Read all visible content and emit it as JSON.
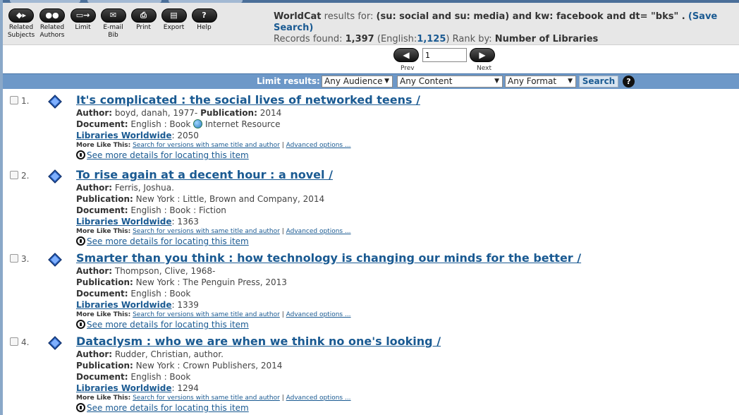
{
  "toolbar": {
    "tools": [
      {
        "label": "Related Subjects",
        "icon": "related-subjects-icon"
      },
      {
        "label": "Related Authors",
        "icon": "related-authors-icon"
      },
      {
        "label": "Limit",
        "icon": "limit-icon"
      },
      {
        "label": "E-mail Bib",
        "icon": "email-icon"
      },
      {
        "label": "Print",
        "icon": "print-icon"
      },
      {
        "label": "Export",
        "icon": "export-icon"
      },
      {
        "label": "Help",
        "icon": "help-icon"
      }
    ],
    "summary": {
      "source": "WorldCat",
      "results_for": "results for:",
      "query": "(su: social and su: media) and kw: facebook and dt= \"bks\" .",
      "save_search": "(Save Search)",
      "records_label": "Records found:",
      "records_count": "1,397",
      "english_open": "(English:",
      "english_count": "1,125",
      "english_close": ")",
      "rank_label": "Rank by:",
      "rank_value": "Number of Libraries"
    }
  },
  "pager": {
    "page_value": "1",
    "prev_label": "Prev",
    "next_label": "Next"
  },
  "limit": {
    "label": "Limit results:",
    "audience": "Any Audience",
    "content": "Any Content",
    "format": "Any Format",
    "search_label": "Search",
    "help": "?"
  },
  "results": [
    {
      "num": "1.",
      "title": "It's complicated : the social lives of networked teens /",
      "author_label": "Author:",
      "author": "boyd, danah, 1977-",
      "publication_label": "Publication:",
      "publication": "2014",
      "document_label": "Document:",
      "document": "English : Book",
      "document_extra": "Internet Resource",
      "libraries_label": "Libraries Worldwide",
      "libraries": ": 2050",
      "more_label": "More Like This:",
      "more_link1": "Search for versions with same title and author",
      "more_sep": "|",
      "more_link2": "Advanced options ...",
      "details": "See more details for locating this item"
    },
    {
      "num": "2.",
      "title": "To rise again at a decent hour : a novel /",
      "author_label": "Author:",
      "author": "Ferris, Joshua.",
      "publication_label": "Publication:",
      "publication": "New York : Little, Brown and Company, 2014",
      "document_label": "Document:",
      "document": "English : Book : Fiction",
      "libraries_label": "Libraries Worldwide",
      "libraries": ": 1363",
      "more_label": "More Like This:",
      "more_link1": "Search for versions with same title and author",
      "more_sep": "|",
      "more_link2": "Advanced options ...",
      "details": "See more details for locating this item"
    },
    {
      "num": "3.",
      "title": "Smarter than you think : how technology is changing our minds for the better /",
      "author_label": "Author:",
      "author": "Thompson, Clive, 1968-",
      "publication_label": "Publication:",
      "publication": "New York : The Penguin Press, 2013",
      "document_label": "Document:",
      "document": "English : Book",
      "libraries_label": "Libraries Worldwide",
      "libraries": ": 1339",
      "more_label": "More Like This:",
      "more_link1": "Search for versions with same title and author",
      "more_sep": "|",
      "more_link2": "Advanced options ...",
      "details": "See more details for locating this item"
    },
    {
      "num": "4.",
      "title": "Dataclysm : who we are when we think no one's looking /",
      "author_label": "Author:",
      "author": "Rudder, Christian, author.",
      "publication_label": "Publication:",
      "publication": "New York : Crown Publishers, 2014",
      "document_label": "Document:",
      "document": "English : Book",
      "libraries_label": "Libraries Worldwide",
      "libraries": ": 1294",
      "more_label": "More Like This:",
      "more_link1": "Search for versions with same title and author",
      "more_sep": "|",
      "more_link2": "Advanced options ...",
      "details": "See more details for locating this item"
    }
  ]
}
